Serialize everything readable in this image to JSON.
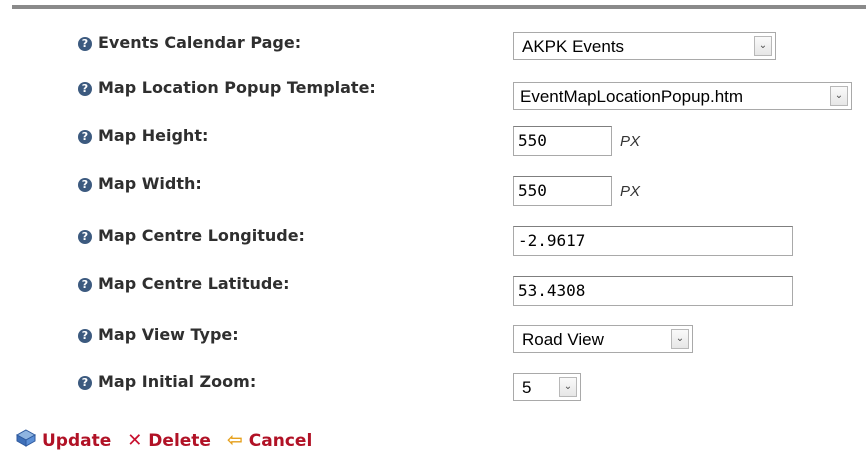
{
  "form": {
    "fields": [
      {
        "label": "Events Calendar Page:",
        "kind": "select",
        "value": "AKPK Events"
      },
      {
        "label": "Map Location Popup Template:",
        "kind": "select",
        "value": "EventMapLocationPopup.htm"
      },
      {
        "label": "Map Height:",
        "kind": "input",
        "value": "550",
        "unit": "PX"
      },
      {
        "label": "Map Width:",
        "kind": "input",
        "value": "550",
        "unit": "PX"
      },
      {
        "label": "Map Centre Longitude:",
        "kind": "input",
        "value": "-2.9617"
      },
      {
        "label": "Map Centre Latitude:",
        "kind": "input",
        "value": "53.4308"
      },
      {
        "label": "Map View Type:",
        "kind": "select",
        "value": "Road View"
      },
      {
        "label": "Map Initial Zoom:",
        "kind": "select",
        "value": "5"
      }
    ]
  },
  "actions": {
    "update": "Update",
    "delete": "Delete",
    "cancel": "Cancel"
  },
  "icons": {
    "help": "help-icon",
    "dropdown": "chevron-down-icon",
    "update": "save-disk-icon",
    "delete": "x-icon",
    "cancel": "back-arrow-icon"
  },
  "colors": {
    "label_text": "#2f2f2f",
    "action_text": "#b11226",
    "help_icon": "#3c5a7f",
    "cancel_arrow": "#e6a01c"
  }
}
